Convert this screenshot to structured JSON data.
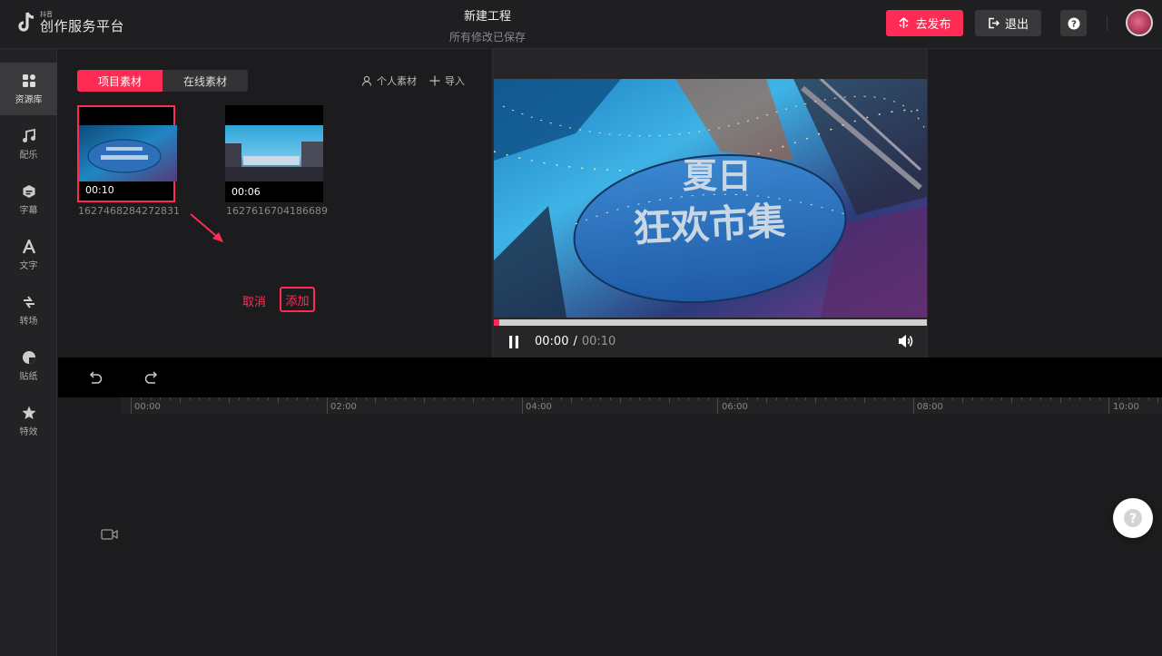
{
  "brand": {
    "small": "抖音",
    "name": "创作服务平台"
  },
  "project": {
    "title": "新建工程",
    "status": "所有修改已保存"
  },
  "header": {
    "publish_label": "去发布",
    "exit_label": "退出"
  },
  "sidebar": {
    "items": [
      {
        "label": "资源库",
        "icon": "resource-library-icon"
      },
      {
        "label": "配乐",
        "icon": "music-note-icon"
      },
      {
        "label": "字幕",
        "icon": "subtitle-icon"
      },
      {
        "label": "文字",
        "icon": "text-icon"
      },
      {
        "label": "转场",
        "icon": "transition-icon"
      },
      {
        "label": "贴纸",
        "icon": "sticker-icon"
      },
      {
        "label": "特效",
        "icon": "effects-icon"
      }
    ]
  },
  "resources": {
    "tabs": [
      {
        "label": "项目素材"
      },
      {
        "label": "在线素材"
      }
    ],
    "personal_label": "个人素材",
    "import_label": "导入",
    "items": [
      {
        "name": "1627468284272831",
        "duration": "00:10",
        "selected": true
      },
      {
        "name": "1627616704186689",
        "duration": "00:06",
        "selected": false
      }
    ],
    "cancel_label": "取消",
    "add_label": "添加"
  },
  "video_overlay": {
    "line1": "夏日",
    "line2": "狂欢市集"
  },
  "player": {
    "current": "00:00",
    "separator": "/",
    "total": "00:10",
    "progress": 0.012
  },
  "timeline": {
    "ticks": [
      "00:00",
      "02:00",
      "04:00",
      "06:00",
      "08:00",
      "10:00"
    ]
  },
  "colors": {
    "accent": "#fe2c55",
    "background": "#1c1c1e"
  }
}
